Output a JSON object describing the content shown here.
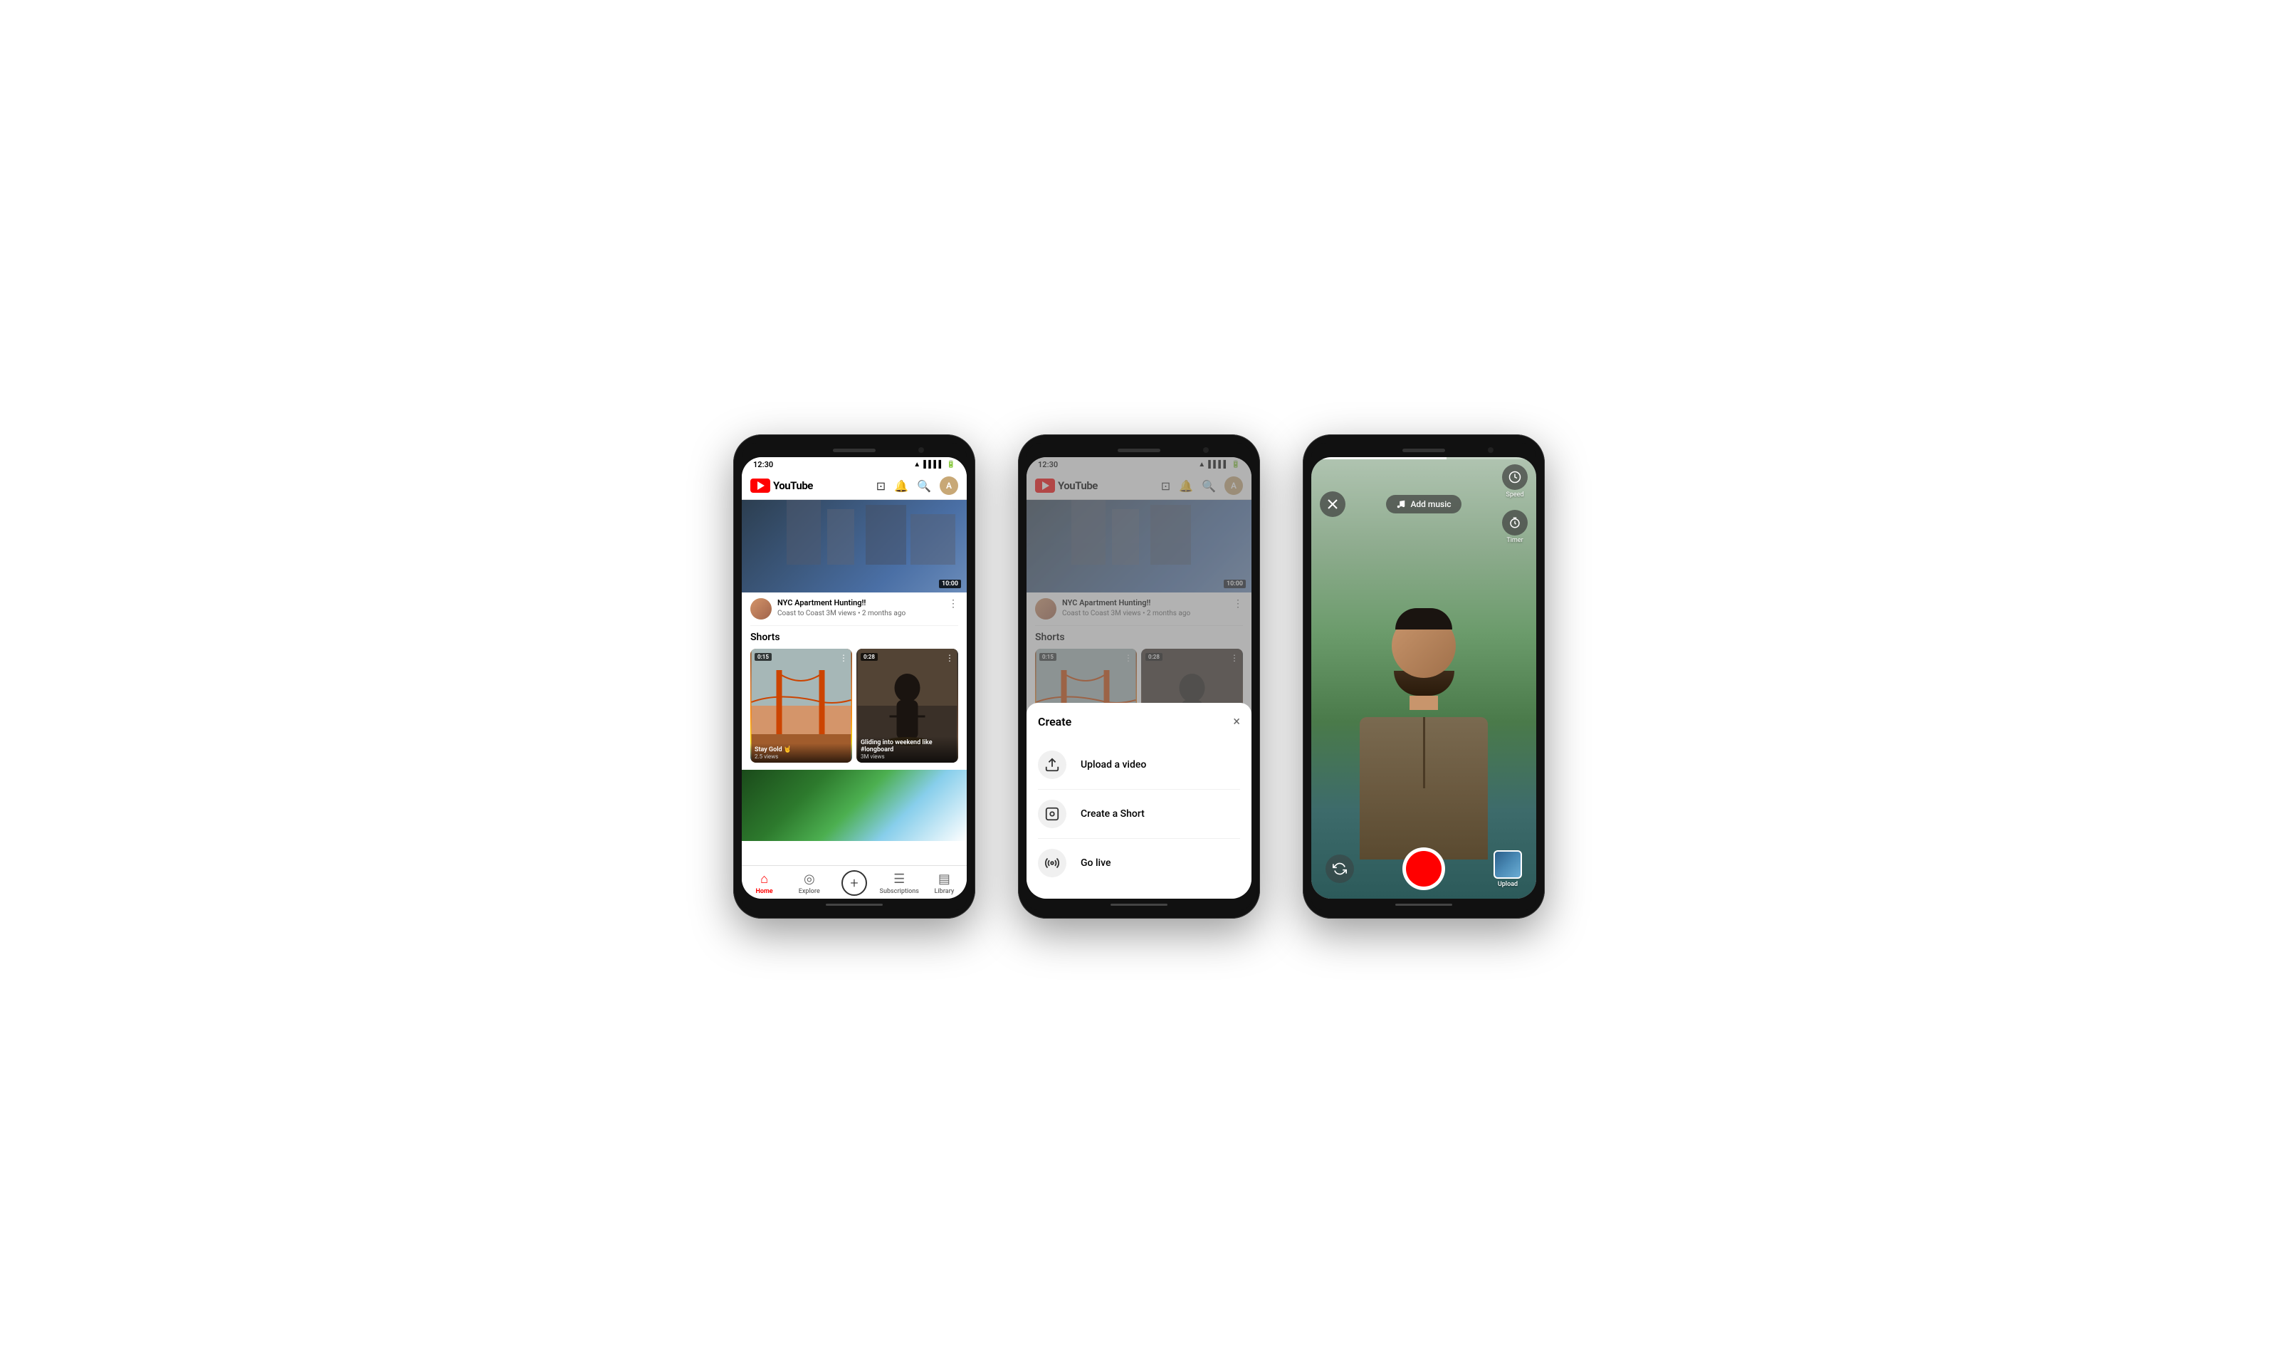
{
  "phones": {
    "phone1": {
      "status_time": "12:30",
      "header": {
        "logo_text": "YouTube",
        "icons": [
          "cast",
          "bell",
          "search",
          "avatar"
        ]
      },
      "video": {
        "duration": "10:00",
        "title": "NYC Apartment Hunting!!",
        "channel": "Coast to Coast",
        "meta": "3M views • 2 months ago"
      },
      "shorts": {
        "section_title": "Shorts",
        "items": [
          {
            "duration": "0:15",
            "title": "Stay Gold 🤘",
            "views": "2.5 views"
          },
          {
            "duration": "0:28",
            "title": "Gliding into weekend like #longboard",
            "views": "3M views"
          }
        ]
      },
      "bottom_nav": {
        "items": [
          {
            "label": "Home",
            "active": true
          },
          {
            "label": "Explore",
            "active": false
          },
          {
            "label": "",
            "is_create": true
          },
          {
            "label": "Subscriptions",
            "active": false
          },
          {
            "label": "Library",
            "active": false
          }
        ]
      }
    },
    "phone2": {
      "status_time": "12:30",
      "modal": {
        "title": "Create",
        "close_label": "×",
        "items": [
          {
            "icon": "upload",
            "label": "Upload a video"
          },
          {
            "icon": "camera",
            "label": "Create a Short"
          },
          {
            "icon": "live",
            "label": "Go live"
          }
        ]
      }
    },
    "phone3": {
      "add_music_label": "Add music",
      "speed_label": "Speed",
      "timer_label": "Timer",
      "upload_label": "Upload",
      "close_label": "×"
    }
  }
}
